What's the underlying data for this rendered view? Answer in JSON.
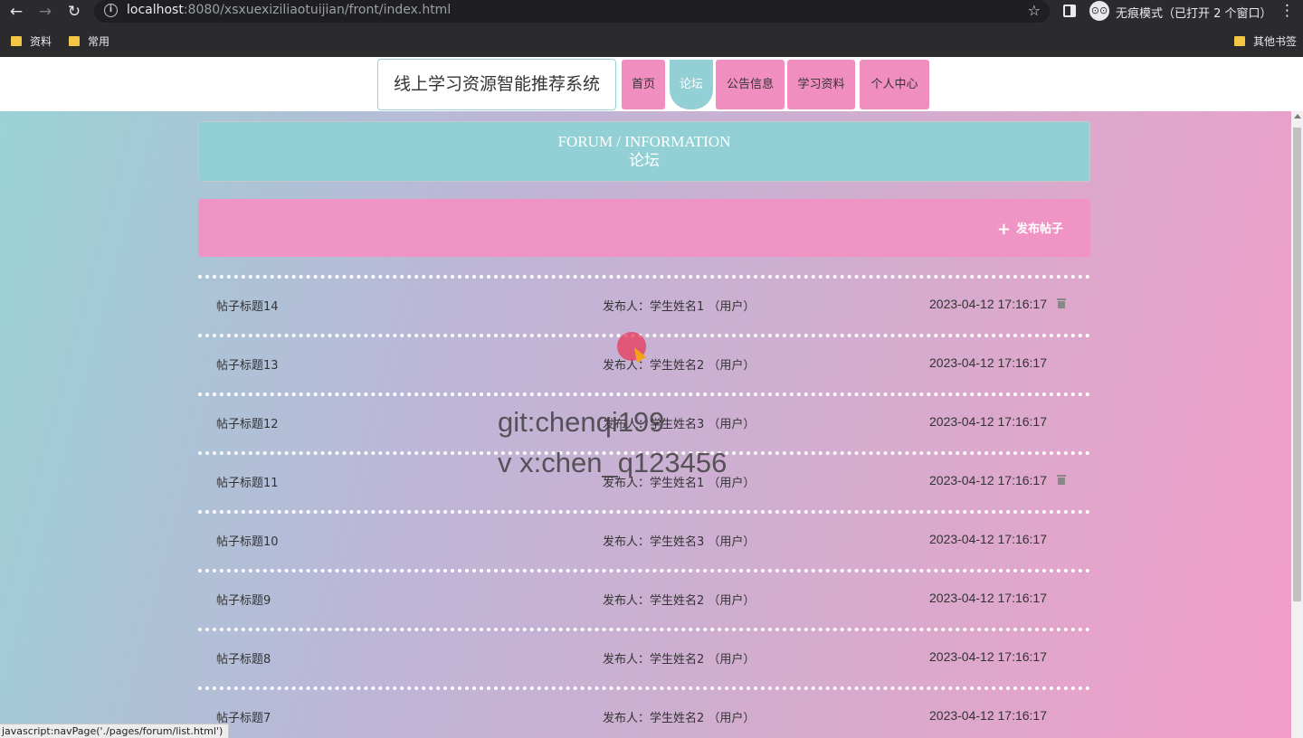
{
  "browser": {
    "url_host": "localhost",
    "url_rest": ":8080/xsxuexiziliaotuijian/front/index.html",
    "incognito_label": "无痕模式（已打开 2 个窗口）",
    "bookmarks": [
      "资料",
      "常用"
    ],
    "other_bookmarks": "其他书签",
    "icons": {
      "back": "←",
      "forward": "→",
      "reload": "↻",
      "info": "i",
      "star": "☆",
      "menu": "⋮",
      "incognito": "⊙⊙"
    }
  },
  "site": {
    "logo": "线上学习资源智能推荐系统",
    "nav": [
      "首页",
      "论坛",
      "公告信息",
      "学习资料",
      "个人中心"
    ],
    "active_nav": "论坛"
  },
  "forum": {
    "title_en": "FORUM / INFORMATION",
    "title_zh": "论坛",
    "add_post_icon": "+",
    "add_post_label": "发布帖子",
    "posts": [
      {
        "title": "帖子标题14",
        "author": "发布人：学生姓名1 （用户）",
        "time": "2023-04-12 17:16:17",
        "deletable": true
      },
      {
        "title": "帖子标题13",
        "author": "发布人：学生姓名2 （用户）",
        "time": "2023-04-12 17:16:17",
        "deletable": false
      },
      {
        "title": "帖子标题12",
        "author": "发布人：学生姓名3 （用户）",
        "time": "2023-04-12 17:16:17",
        "deletable": false
      },
      {
        "title": "帖子标题11",
        "author": "发布人：学生姓名1 （用户）",
        "time": "2023-04-12 17:16:17",
        "deletable": true
      },
      {
        "title": "帖子标题10",
        "author": "发布人：学生姓名3 （用户）",
        "time": "2023-04-12 17:16:17",
        "deletable": false
      },
      {
        "title": "帖子标题9",
        "author": "发布人：学生姓名2 （用户）",
        "time": "2023-04-12 17:16:17",
        "deletable": false
      },
      {
        "title": "帖子标题8",
        "author": "发布人：学生姓名2 （用户）",
        "time": "2023-04-12 17:16:17",
        "deletable": false
      },
      {
        "title": "帖子标题7",
        "author": "发布人：学生姓名2 （用户）",
        "time": "2023-04-12 17:16:17",
        "deletable": false
      }
    ]
  },
  "watermark": {
    "line1": "git:chenqi199",
    "line2": "v x:chen_q123456"
  },
  "status_bar": "javascript:navPage('./pages/forum/list.html')",
  "colors": {
    "nav_pink": "#f08fbf",
    "nav_active_teal": "#93d0d6",
    "action_bar_pink": "#ef94c4"
  }
}
